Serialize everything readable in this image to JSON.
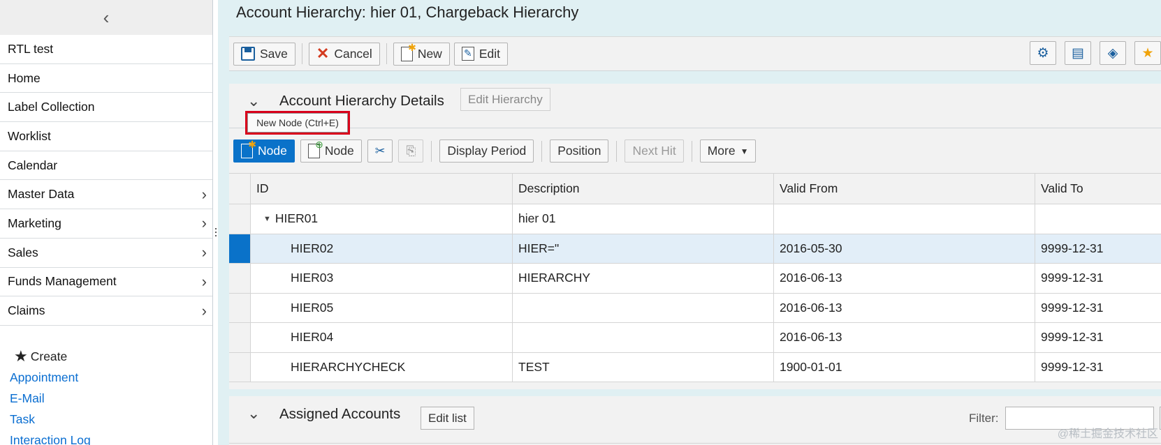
{
  "sidebar": {
    "collapse_icon": "chevron-left-icon",
    "collapse_glyph": "‹",
    "items": [
      {
        "label": "RTL test",
        "has_children": false
      },
      {
        "label": "Home",
        "has_children": false
      },
      {
        "label": "Label Collection",
        "has_children": false
      },
      {
        "label": "Worklist",
        "has_children": false
      },
      {
        "label": "Calendar",
        "has_children": false
      },
      {
        "label": "Master Data",
        "has_children": true
      },
      {
        "label": "Marketing",
        "has_children": true
      },
      {
        "label": "Sales",
        "has_children": true
      },
      {
        "label": "Funds Management",
        "has_children": true
      },
      {
        "label": "Claims",
        "has_children": true
      }
    ],
    "create": {
      "title": "Create",
      "links": [
        "Appointment",
        "E-Mail",
        "Task",
        "Interaction Log"
      ]
    }
  },
  "page": {
    "title": "Account Hierarchy: hier 01, Chargeback Hierarchy"
  },
  "toolbar": {
    "save_label": "Save",
    "cancel_label": "Cancel",
    "new_label": "New",
    "edit_label": "Edit",
    "right_icons": [
      "settings-icon",
      "personalize-icon",
      "tag-icon",
      "favorite-add-icon"
    ]
  },
  "details": {
    "title": "Account Hierarchy Details",
    "edit_hierarchy_label": "Edit Hierarchy",
    "tooltip": "New Node (Ctrl+E)",
    "tree_toolbar": {
      "node_primary_label": "Node",
      "node_child_label": "Node",
      "display_period_label": "Display Period",
      "position_label": "Position",
      "next_hit_label": "Next Hit",
      "more_label": "More"
    },
    "columns": [
      "ID",
      "Description",
      "Valid From",
      "Valid To"
    ],
    "rows": [
      {
        "id": "HIER01",
        "description": "hier 01",
        "valid_from": "",
        "valid_to": "",
        "level": 0,
        "expanded": true,
        "selected": false
      },
      {
        "id": "HIER02",
        "description": "HIER=\"",
        "valid_from": "2016-05-30",
        "valid_to": "9999-12-31",
        "level": 1,
        "selected": true
      },
      {
        "id": "HIER03",
        "description": "HIERARCHY",
        "valid_from": "2016-06-13",
        "valid_to": "9999-12-31",
        "level": 1,
        "selected": false
      },
      {
        "id": "HIER05",
        "description": "",
        "valid_from": "2016-06-13",
        "valid_to": "9999-12-31",
        "level": 1,
        "selected": false
      },
      {
        "id": "HIER04",
        "description": "",
        "valid_from": "2016-06-13",
        "valid_to": "9999-12-31",
        "level": 1,
        "selected": false
      },
      {
        "id": "HIERARCHYCHECK",
        "description": "TEST",
        "valid_from": "1900-01-01",
        "valid_to": "9999-12-31",
        "level": 1,
        "selected": false
      }
    ]
  },
  "assigned": {
    "title": "Assigned Accounts",
    "edit_list_label": "Edit list",
    "filter_label": "Filter:",
    "filter_value": ""
  },
  "watermark": "@稀土掘金技术社区",
  "colors": {
    "accent": "#0a72c9",
    "link": "#0a6ed1",
    "tooltip_border": "#d9001b",
    "background": "#e0f0f3"
  }
}
